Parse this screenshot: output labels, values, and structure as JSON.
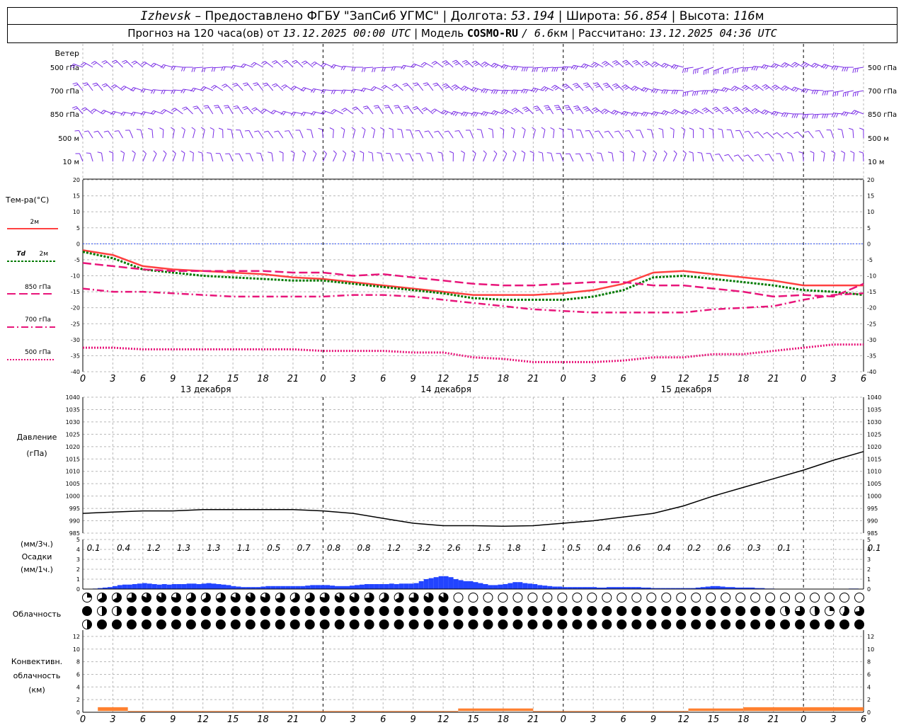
{
  "header": {
    "city": "Izhevsk",
    "dash": "–",
    "provider": "Предоставлено ФГБУ \"ЗапСиб УГМС\"",
    "sep": "|",
    "lon_label": "Долгота:",
    "lon_value": "53.194",
    "lat_label": "Широта:",
    "lat_value": "56.854",
    "alt_label": "Высота:",
    "alt_value": "116",
    "alt_unit": "м",
    "forecast_prefix": "Прогноз на 120 часа(ов) от",
    "forecast_start": "13.12.2025 00:00 UTC",
    "model_label": "Модель",
    "model_name": "COSMO-RU",
    "model_res": "/ 6.6",
    "model_res_unit": "км",
    "calc_label": "Рассчитано:",
    "calc_time": "13.12.2025 04:36 UTC"
  },
  "colors": {
    "wind": "#7a2ee6",
    "t2m": "#ff4040",
    "td2m": "#007a00",
    "t850": "#e8157a",
    "t700": "#e8157a",
    "t500": "#e8157a",
    "zero_line": "#3355ff",
    "precip": "#2244ff",
    "conv": "#ff8030",
    "cloud": "#000000"
  },
  "chart_data": [
    {
      "type": "wind_barbs",
      "title": "Ветер",
      "levels": [
        "500 гПа",
        "700 гПа",
        "850 гПа",
        "500 м",
        "10 м"
      ],
      "interval_h": 1,
      "note_visible": "wind barbs for each hour, 5 levels"
    },
    {
      "type": "line",
      "ylabel": "Тем-ра(°C)",
      "ylim": [
        -40,
        20
      ],
      "yticks": [
        20,
        15,
        10,
        5,
        0,
        -5,
        -10,
        -15,
        -20,
        -25,
        -30,
        -35,
        -40
      ],
      "x_ticks": [
        "0",
        "3",
        "6",
        "9",
        "12",
        "15",
        "18",
        "21",
        "0",
        "3",
        "6",
        "9",
        "12",
        "15",
        "18",
        "21",
        "0",
        "3",
        "6",
        "9",
        "12",
        "15",
        "18",
        "21",
        "0",
        "3",
        "6"
      ],
      "day_labels": [
        "13 декабря",
        "14 декабря",
        "15 декабря"
      ],
      "hours": [
        0,
        3,
        6,
        9,
        12,
        15,
        18,
        21,
        24,
        27,
        30,
        33,
        36,
        39,
        42,
        45,
        48,
        51,
        54,
        57,
        60,
        63,
        66,
        69,
        72,
        75,
        78
      ],
      "series": [
        {
          "name": "2м",
          "values": [
            -2,
            -3.5,
            -7,
            -8,
            -8.5,
            -9,
            -9.5,
            -10.5,
            -11,
            -12,
            -13,
            -14,
            -15,
            -16,
            -16,
            -16,
            -15.5,
            -14.5,
            -12.5,
            -9,
            -8.5,
            -9.5,
            -10.5,
            -11.5,
            -13,
            -13,
            -13
          ]
        },
        {
          "name": "Td 2м",
          "values": [
            -2.5,
            -4.5,
            -8,
            -9,
            -10,
            -10.5,
            -11,
            -11.5,
            -11.5,
            -12.5,
            -13.5,
            -14.5,
            -15.5,
            -17,
            -17.5,
            -17.5,
            -17.5,
            -16.5,
            -14.5,
            -10.5,
            -10,
            -11,
            -12,
            -13,
            -14.5,
            -15,
            -16
          ]
        },
        {
          "name": "850 гПа",
          "values": [
            -6,
            -7,
            -8,
            -8.5,
            -8.5,
            -8.5,
            -8.5,
            -9,
            -9,
            -10,
            -9.5,
            -10.5,
            -11.5,
            -12.5,
            -13,
            -13,
            -12.5,
            -12,
            -12,
            -13,
            -13,
            -14,
            -15,
            -16.5,
            -16,
            -16.5,
            -12.5
          ]
        },
        {
          "name": "700 гПа",
          "values": [
            -14,
            -15,
            -15,
            -15.5,
            -16,
            -16.5,
            -16.5,
            -16.5,
            -16.5,
            -16,
            -16,
            -16.5,
            -17.5,
            -18.5,
            -19.5,
            -20.5,
            -21,
            -21.5,
            -21.5,
            -21.5,
            -21.5,
            -20.5,
            -20,
            -19.5,
            -17.5,
            -16,
            -15.5
          ]
        },
        {
          "name": "500 гПа",
          "values": [
            -32.5,
            -32.5,
            -33,
            -33,
            -33,
            -33,
            -33,
            -33,
            -33.5,
            -33.5,
            -33.5,
            -34,
            -34,
            -35.5,
            -36,
            -37,
            -37,
            -37,
            -36.5,
            -35.5,
            -35.5,
            -34.5,
            -34.5,
            -33.5,
            -32.5,
            -31.5,
            -31.5
          ]
        }
      ]
    },
    {
      "type": "line",
      "ylabel": "Давление",
      "yunit": "(гПа)",
      "ylim": [
        985,
        1040
      ],
      "yticks": [
        1040,
        1035,
        1030,
        1025,
        1020,
        1015,
        1010,
        1005,
        1000,
        995,
        990,
        985
      ],
      "hours": [
        0,
        3,
        6,
        9,
        12,
        15,
        18,
        21,
        24,
        27,
        30,
        33,
        36,
        39,
        42,
        45,
        48,
        51,
        54,
        57,
        60,
        63,
        66,
        69,
        72,
        75,
        78
      ],
      "series": [
        {
          "name": "",
          "values": [
            993,
            993.5,
            994,
            994,
            994.5,
            994.5,
            994.5,
            994.5,
            994,
            993,
            991,
            989,
            988,
            988,
            987.8,
            988,
            989,
            990,
            991.5,
            993,
            996,
            1000,
            1003.5,
            1007,
            1010.5,
            1014.5,
            1018
          ]
        }
      ]
    },
    {
      "type": "bar",
      "ylabel_top": "(мм/3ч.)",
      "ylabel": "Осадки",
      "yunit": "(мм/1ч.)",
      "ylim": [
        0,
        5
      ],
      "yticks": [
        5,
        4,
        3,
        2,
        1,
        0
      ],
      "totals_3h": [
        "0.1",
        "0.4",
        "1.2",
        "1.3",
        "1.3",
        "1.1",
        "0.5",
        "0.7",
        "0.8",
        "0.8",
        "1.2",
        "3.2",
        "2.6",
        "1.5",
        "1.8",
        "1",
        "0.5",
        "0.4",
        "0.6",
        "0.4",
        "0.2",
        "0.6",
        "0.3",
        "0.1",
        "",
        "",
        "0.1"
      ],
      "hourly_values": [
        0,
        0,
        0.05,
        0.1,
        0.15,
        0.2,
        0.3,
        0.4,
        0.45,
        0.45,
        0.5,
        0.55,
        0.6,
        0.55,
        0.5,
        0.45,
        0.5,
        0.45,
        0.5,
        0.5,
        0.5,
        0.55,
        0.55,
        0.5,
        0.55,
        0.6,
        0.55,
        0.5,
        0.45,
        0.4,
        0.3,
        0.25,
        0.2,
        0.2,
        0.2,
        0.2,
        0.25,
        0.3,
        0.3,
        0.3,
        0.3,
        0.3,
        0.3,
        0.3,
        0.3,
        0.35,
        0.4,
        0.4,
        0.4,
        0.4,
        0.35,
        0.3,
        0.3,
        0.3,
        0.35,
        0.4,
        0.45,
        0.5,
        0.5,
        0.5,
        0.5,
        0.5,
        0.55,
        0.5,
        0.55,
        0.55,
        0.55,
        0.6,
        0.8,
        1.0,
        1.1,
        1.2,
        1.3,
        1.3,
        1.2,
        1.0,
        0.9,
        0.8,
        0.8,
        0.7,
        0.6,
        0.5,
        0.4,
        0.4,
        0.45,
        0.5,
        0.6,
        0.7,
        0.7,
        0.6,
        0.55,
        0.5,
        0.4,
        0.35,
        0.3,
        0.25,
        0.25,
        0.2,
        0.2,
        0.2,
        0.2,
        0.2,
        0.2,
        0.2,
        0.15,
        0.15,
        0.2,
        0.2,
        0.2,
        0.2,
        0.2,
        0.2,
        0.2,
        0.15,
        0.15,
        0.1,
        0.1,
        0.1,
        0.1,
        0.1,
        0.1,
        0.1,
        0.1,
        0.1,
        0.15,
        0.2,
        0.25,
        0.3,
        0.3,
        0.25,
        0.2,
        0.2,
        0.15,
        0.15,
        0.15,
        0.15,
        0.1,
        0.1,
        0.05,
        0.05,
        0,
        0,
        0,
        0,
        0,
        0,
        0,
        0,
        0,
        0,
        0,
        0,
        0,
        0,
        0.02,
        0.05,
        0.05,
        0
      ]
    },
    {
      "type": "cloud_symbols",
      "title": "Облачность",
      "rows": 3,
      "columns": 53,
      "note_visible": "circle symbols, filled fraction = cloud cover"
    },
    {
      "type": "area",
      "ylabel": "Конвективн. облачность (км)",
      "ylim": [
        0,
        13
      ],
      "yticks": [
        12,
        10,
        8,
        6,
        4,
        2,
        0
      ],
      "x_ticks": [
        "0",
        "3",
        "6",
        "9",
        "12",
        "15",
        "18",
        "21",
        "0",
        "3",
        "6",
        "9",
        "12",
        "15",
        "18",
        "21",
        "0",
        "3",
        "6",
        "9",
        "12",
        "15",
        "18",
        "21",
        "0",
        "3",
        "6"
      ],
      "segments": [
        {
          "from_h": 1.5,
          "to_h": 4.5,
          "top_km": 0.8,
          "base_km": 0.2
        },
        {
          "from_h": 4.5,
          "to_h": 37.5,
          "top_km": 0.2,
          "base_km": 0.15
        },
        {
          "from_h": 37.5,
          "to_h": 45,
          "top_km": 0.6,
          "base_km": 0.2
        },
        {
          "from_h": 45,
          "to_h": 60.5,
          "top_km": 0.2,
          "base_km": 0.15
        },
        {
          "from_h": 60.5,
          "to_h": 66,
          "top_km": 0.6,
          "base_km": 0.2
        },
        {
          "from_h": 66,
          "to_h": 72,
          "top_km": 0.8,
          "base_km": 0.2
        },
        {
          "from_h": 72,
          "to_h": 78,
          "top_km": 0.8,
          "base_km": 0.2
        }
      ]
    }
  ],
  "legend": {
    "t2m": "2м",
    "td2m_a": "Td",
    "td2m_b": "2м",
    "t850": "850 гПа",
    "t700": "700 гПа",
    "t500": "500 гПа"
  }
}
